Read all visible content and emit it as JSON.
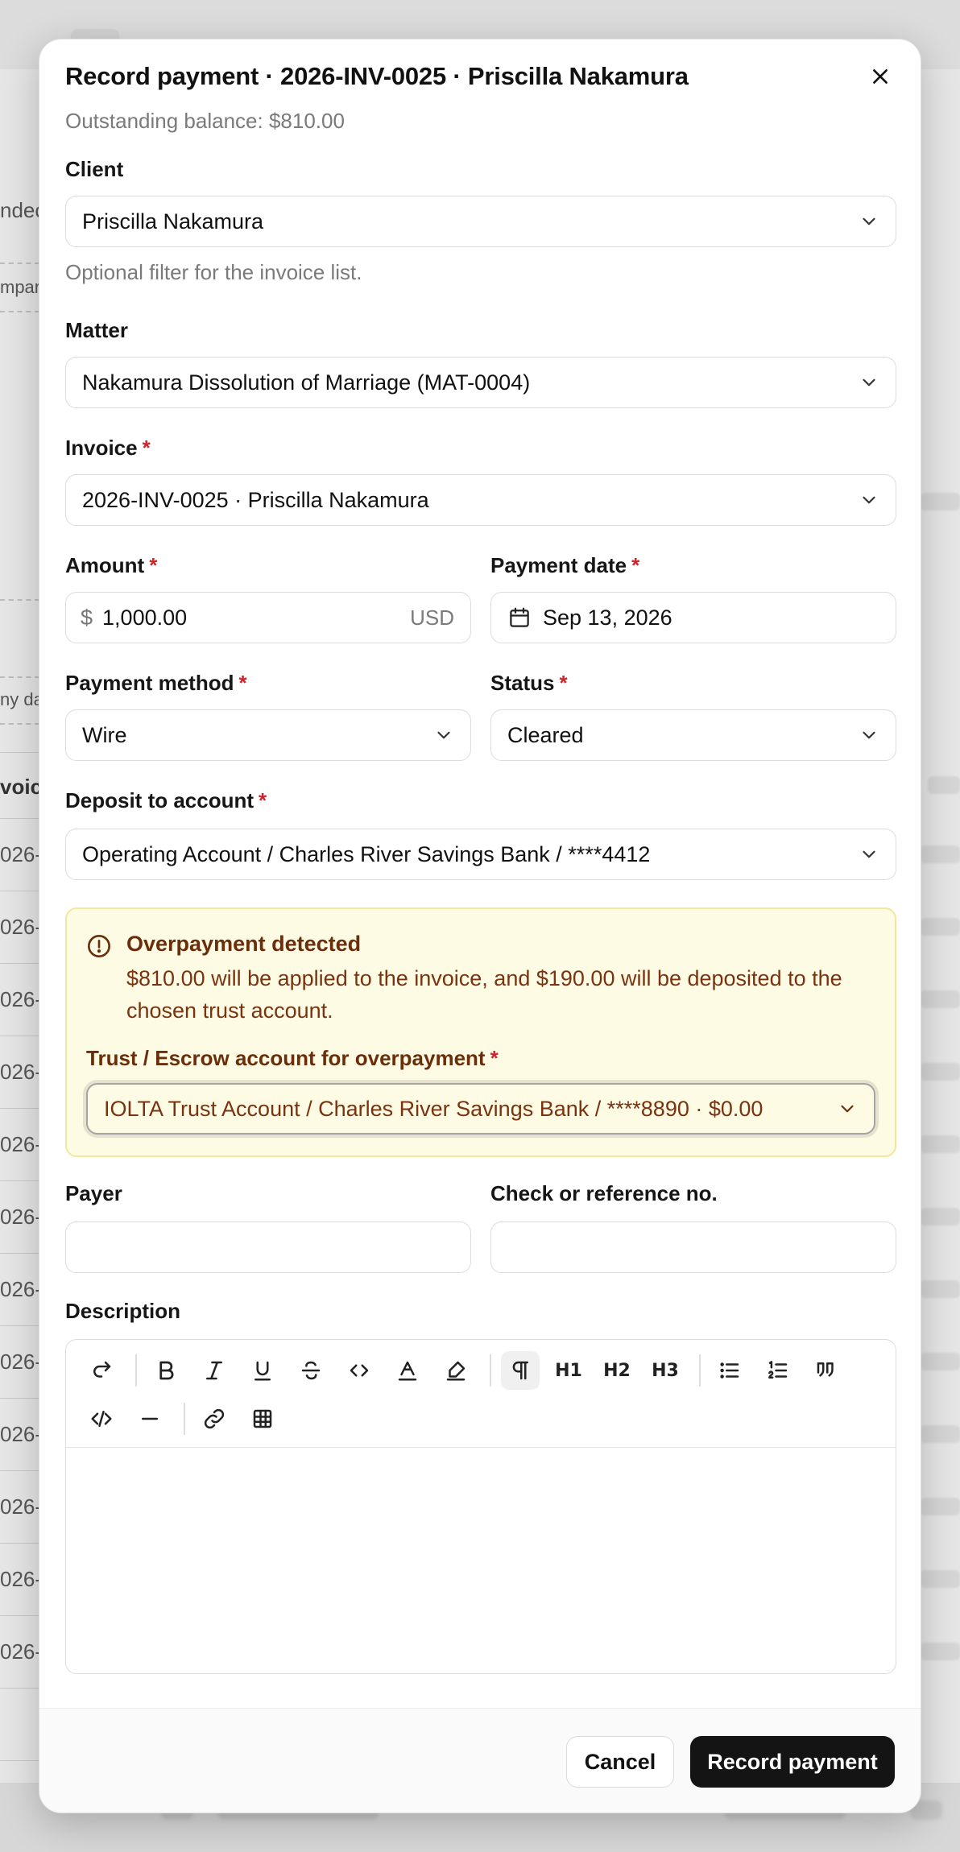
{
  "background": {
    "fragments": [
      "ndec",
      "mpar",
      "ny da",
      "voic",
      "026-",
      "026-",
      "026-",
      "026-",
      "026-",
      "026-",
      "026-",
      "026-",
      "026-",
      "026-",
      "026-",
      "026-"
    ]
  },
  "modal": {
    "title": "Record payment · 2026-INV-0025 · Priscilla Nakamura",
    "subtitle": "Outstanding balance: $810.00"
  },
  "form": {
    "client": {
      "label": "Client",
      "value": "Priscilla Nakamura",
      "help": "Optional filter for the invoice list."
    },
    "matter": {
      "label": "Matter",
      "value": "Nakamura Dissolution of Marriage (MAT-0004)"
    },
    "invoice": {
      "label": "Invoice",
      "required_mark": "*",
      "value": "2026-INV-0025 · Priscilla Nakamura"
    },
    "amount": {
      "label": "Amount",
      "required_mark": "*",
      "prefix": "$",
      "value": "1,000.00",
      "suffix": "USD"
    },
    "payment_date": {
      "label": "Payment date",
      "required_mark": "*",
      "value": "Sep 13, 2026"
    },
    "payment_method": {
      "label": "Payment method",
      "required_mark": "*",
      "value": "Wire"
    },
    "status": {
      "label": "Status",
      "required_mark": "*",
      "value": "Cleared"
    },
    "deposit_account": {
      "label": "Deposit to account",
      "required_mark": "*",
      "value": "Operating Account / Charles River Savings Bank / ****4412"
    },
    "payer": {
      "label": "Payer",
      "value": ""
    },
    "reference": {
      "label": "Check or reference no.",
      "value": ""
    },
    "description": {
      "label": "Description",
      "value": ""
    }
  },
  "alert": {
    "title": "Overpayment detected",
    "body": "$810.00 will be applied to the invoice, and $190.00 will be deposited to the chosen trust account.",
    "trust_label": "Trust / Escrow account for overpayment",
    "required_mark": "*",
    "trust_value": "IOLTA Trust Account / Charles River Savings Bank / ****8890 · $0.00"
  },
  "editor_toolbar": {
    "h1": "H1",
    "h2": "H2",
    "h3": "H3"
  },
  "footer": {
    "cancel_label": "Cancel",
    "submit_label": "Record payment"
  },
  "colors": {
    "required": "#d1232a",
    "alert_bg": "#fefbe5",
    "alert_border": "#f3e79b",
    "alert_text": "#7a3310",
    "primary_button": "#141414"
  }
}
